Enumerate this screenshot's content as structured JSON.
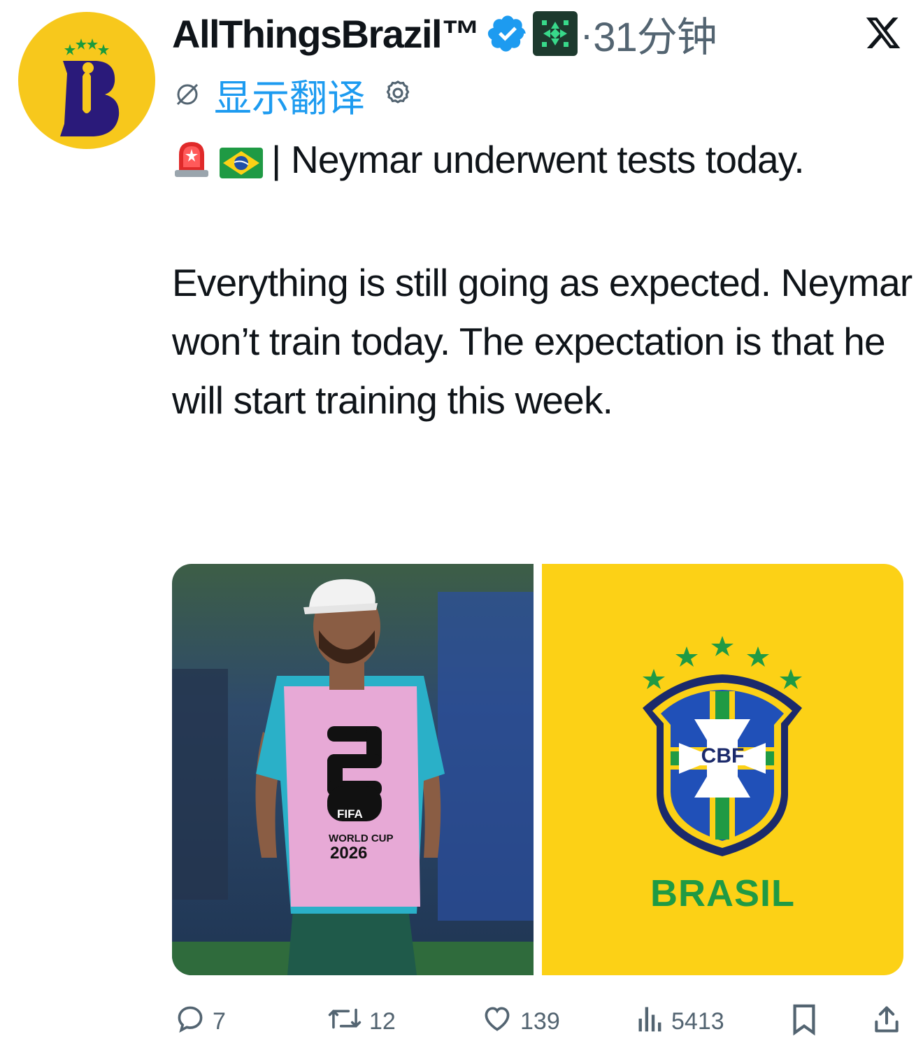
{
  "author": {
    "display_name": "AllThingsBrazil™",
    "timestamp": "31分钟",
    "separator": "·"
  },
  "translate": {
    "label": "显示翻译"
  },
  "tweet": {
    "line1": "| Neymar underwent tests today.",
    "paragraph2": "Everything is still going as expected. Neymar won’t train today. The expectation is that he will start training this week."
  },
  "media": {
    "bib_fifa": "FIFA",
    "bib_world_cup": "WORLD CUP",
    "bib_year": "2026",
    "crest_text": "CBF",
    "brand_text": "BRASIL"
  },
  "actions": {
    "replies": "7",
    "reposts": "12",
    "likes": "139",
    "views": "5413"
  },
  "colors": {
    "accent_blue": "#1d9bf0",
    "muted_gray": "#536471",
    "avatar_yellow": "#f7c81c",
    "brasil_yellow": "#fcd116",
    "brasil_green": "#1f9a44",
    "brasil_blue": "#1f4fa8"
  },
  "icons": [
    "verified-badge-icon",
    "affiliate-badge-icon",
    "x-logo-icon",
    "no-translate-icon",
    "settings-gear-icon",
    "siren-emoji-icon",
    "brazil-flag-emoji-icon",
    "reply-icon",
    "repost-icon",
    "like-icon",
    "views-icon",
    "bookmark-icon",
    "share-icon"
  ]
}
